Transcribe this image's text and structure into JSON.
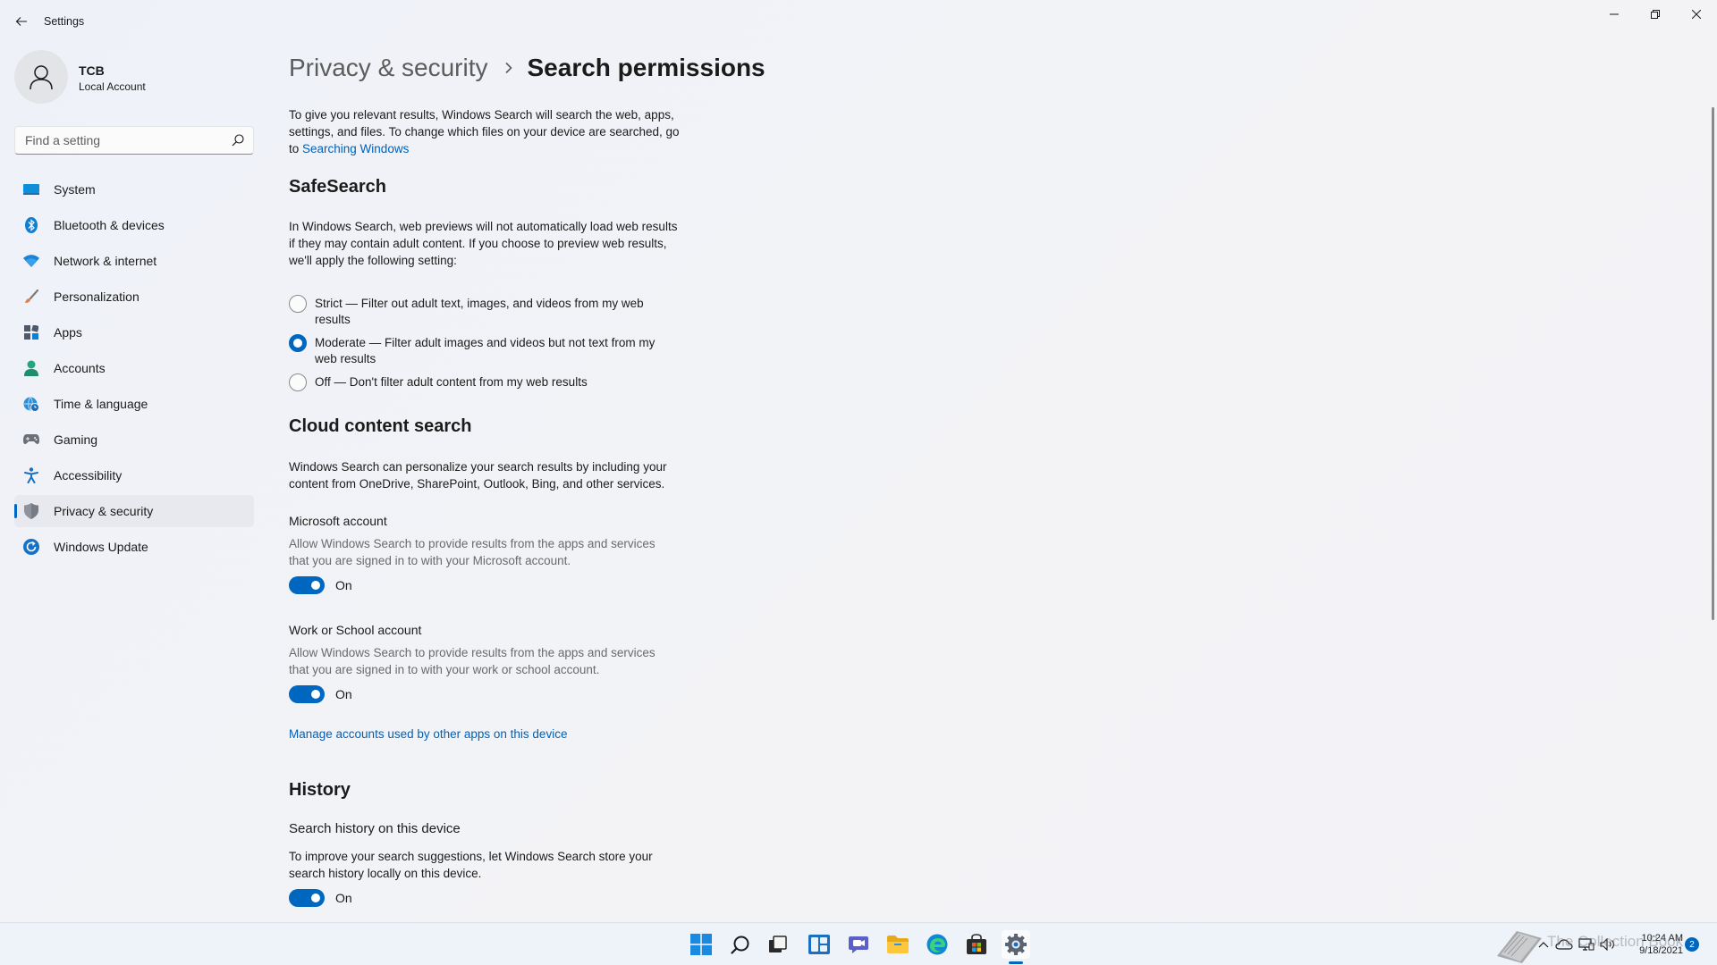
{
  "window": {
    "title": "Settings",
    "back_icon": "back-arrow-icon",
    "controls": [
      "minimize-icon",
      "restore-icon",
      "close-icon"
    ]
  },
  "profile": {
    "name": "TCB",
    "account_type": "Local Account",
    "avatar_icon": "person-icon"
  },
  "search": {
    "placeholder": "Find a setting",
    "icon": "search-icon"
  },
  "sidebar": {
    "items": [
      {
        "label": "System",
        "icon": "system-icon",
        "active": false
      },
      {
        "label": "Bluetooth & devices",
        "icon": "bluetooth-icon",
        "active": false
      },
      {
        "label": "Network & internet",
        "icon": "wifi-icon",
        "active": false
      },
      {
        "label": "Personalization",
        "icon": "brush-icon",
        "active": false
      },
      {
        "label": "Apps",
        "icon": "apps-icon",
        "active": false
      },
      {
        "label": "Accounts",
        "icon": "accounts-icon",
        "active": false
      },
      {
        "label": "Time & language",
        "icon": "globe-clock-icon",
        "active": false
      },
      {
        "label": "Gaming",
        "icon": "gamepad-icon",
        "active": false
      },
      {
        "label": "Accessibility",
        "icon": "accessibility-icon",
        "active": false
      },
      {
        "label": "Privacy & security",
        "icon": "shield-icon",
        "active": true
      },
      {
        "label": "Windows Update",
        "icon": "update-icon",
        "active": false
      }
    ]
  },
  "breadcrumb": {
    "parent": "Privacy & security",
    "current": "Search permissions",
    "separator_icon": "chevron-right-icon"
  },
  "intro": {
    "line1": "To give you relevant results, Windows Search will search the web, apps,",
    "line2": "settings, and files. To change which files on your device are searched, go",
    "line3_prefix": "to ",
    "link": "Searching Windows"
  },
  "safesearch": {
    "title": "SafeSearch",
    "description_lines": [
      "In Windows Search, web previews will not automatically load web results",
      "if they may contain adult content. If you choose to preview web results,",
      "we'll apply the following setting:"
    ],
    "options": [
      {
        "line1": "Strict — Filter out adult text, images, and videos from my web",
        "line2": "results",
        "checked": false
      },
      {
        "line1": "Moderate — Filter adult images and videos but not text from my",
        "line2": "web results",
        "checked": true
      },
      {
        "line1": "Off — Don't filter adult content from my web results",
        "line2": "",
        "checked": false
      }
    ]
  },
  "cloud": {
    "title": "Cloud content search",
    "description_lines": [
      "Windows Search can personalize your search results by including your",
      "content from OneDrive, SharePoint, Outlook, Bing, and other services."
    ],
    "microsoft": {
      "title": "Microsoft account",
      "desc_line1": "Allow Windows Search to provide results from the apps and services",
      "desc_line2": "that you are signed in to with your Microsoft account.",
      "toggle_label": "On",
      "toggle_on": true
    },
    "work": {
      "title": "Work or School account",
      "desc_line1": "Allow Windows Search to provide results from the apps and services",
      "desc_line2": "that you are signed in to with your work or school account.",
      "toggle_label": "On",
      "toggle_on": true
    },
    "manage_link": "Manage accounts used by other apps on this device"
  },
  "history": {
    "title": "History",
    "sub_title": "Search history on this device",
    "desc_line1": "To improve your search suggestions, let Windows Search store your",
    "desc_line2": "search history locally on this device.",
    "toggle_label": "On",
    "toggle_on": true
  },
  "taskbar": {
    "apps": [
      "start-icon",
      "search-icon",
      "task-view-icon",
      "widgets-icon",
      "chat-icon",
      "file-explorer-icon",
      "edge-icon",
      "store-icon",
      "settings-icon"
    ],
    "active_app": "settings-icon",
    "tray_icons": [
      "chevron-up-icon",
      "onedrive-icon",
      "network-icon",
      "volume-icon"
    ],
    "time": "10:24 AM",
    "date": "9/18/2021",
    "notification_count": "2"
  },
  "watermark": {
    "text": "The Collection Book"
  },
  "colors": {
    "accent": "#0067c0",
    "link": "#0060b8",
    "background": "#f3f3f6"
  }
}
